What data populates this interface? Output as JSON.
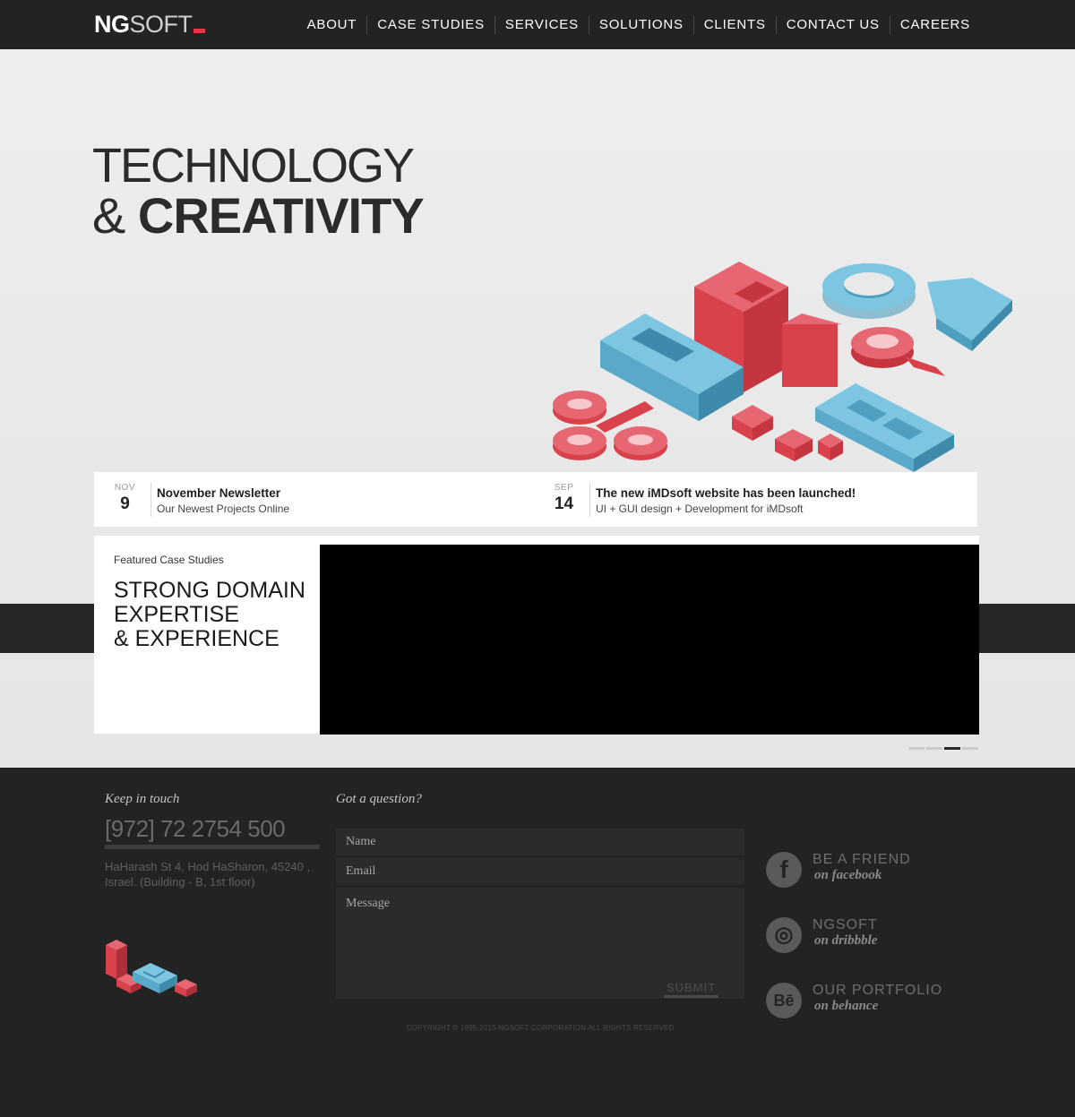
{
  "header": {
    "logo": {
      "bold": "NG",
      "light": "SOFT"
    },
    "nav": [
      "ABOUT",
      "CASE STUDIES",
      "SERVICES",
      "SOLUTIONS",
      "CLIENTS",
      "CONTACT US",
      "CAREERS"
    ]
  },
  "hero": {
    "line1": "TECHNOLOGY",
    "line2_amp": "&",
    "line2_bold": "CREATIVITY"
  },
  "news": [
    {
      "month": "NOV",
      "day": "9",
      "title": "November Newsletter",
      "subtitle": "Our Newest Projects Online"
    },
    {
      "month": "SEP",
      "day": "14",
      "title": "The new iMDsoft website has been launched!",
      "subtitle": "UI + GUI design + Development for iMDsoft"
    }
  ],
  "featured": {
    "label": "Featured Case Studies",
    "heading_lines": [
      "STRONG DOMAIN",
      "EXPERTISE",
      "& EXPERIENCE"
    ],
    "slider": {
      "slides": 4,
      "active_index": 2
    }
  },
  "footer": {
    "keep_in_touch": "Keep in touch",
    "phone": "[972] 72 2754 500",
    "address": "HaHarash St 4, Hod HaSharon, 45240 , Israel. (Building - B, 1st floor)",
    "form": {
      "title": "Got a question?",
      "name_placeholder": "Name",
      "email_placeholder": "Email",
      "message_placeholder": "Message",
      "submit": "SUBMIT"
    },
    "copyright": "COPYRIGHT © 1995-2015 NGSOFT CORPORATION ALL RIGHTS RESERVED",
    "social": [
      {
        "icon": "facebook-icon",
        "glyph": "f",
        "line1": "BE A FRIEND",
        "line2": "on facebook"
      },
      {
        "icon": "dribbble-icon",
        "glyph": "◎",
        "line1": "NGSOFT",
        "line2": "on dribbble"
      },
      {
        "icon": "behance-icon",
        "glyph": "Bē",
        "line1": "OUR PORTFOLIO",
        "line2": "on behance"
      }
    ]
  },
  "colors": {
    "accent_red": "#e03a45",
    "accent_blue": "#6ab8d6",
    "dark": "#232323"
  }
}
